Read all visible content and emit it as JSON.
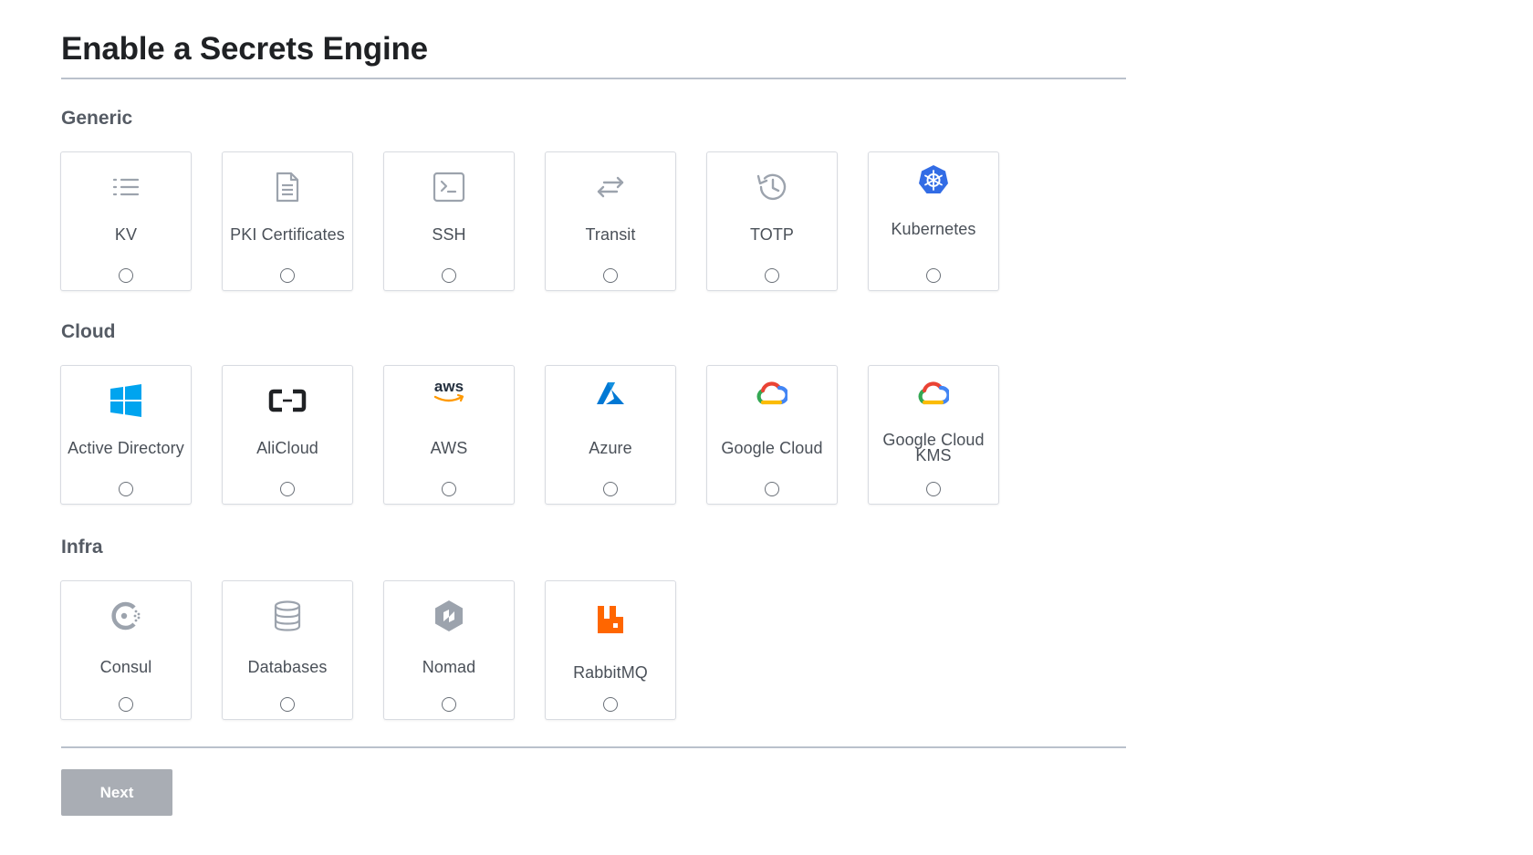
{
  "page_title": "Enable a Secrets Engine",
  "groups": [
    {
      "label": "Generic",
      "engines": [
        {
          "label": "KV",
          "icon": "list-icon",
          "color": "#9ca3ad"
        },
        {
          "label": "PKI Certificates",
          "icon": "document-icon",
          "color": "#9ca3ad"
        },
        {
          "label": "SSH",
          "icon": "terminal-icon",
          "color": "#9ca3ad"
        },
        {
          "label": "Transit",
          "icon": "swap-arrows-icon",
          "color": "#9ca3ad"
        },
        {
          "label": "TOTP",
          "icon": "history-clock-icon",
          "color": "#9ca3ad"
        },
        {
          "label": "Kubernetes",
          "icon": "kubernetes-icon",
          "color": "#326ce5"
        }
      ]
    },
    {
      "label": "Cloud",
      "engines": [
        {
          "label": "Active Directory",
          "icon": "windows-icon",
          "color": "#00a4ef"
        },
        {
          "label": "AliCloud",
          "icon": "alicloud-icon",
          "color": "#1f2124"
        },
        {
          "label": "AWS",
          "icon": "aws-icon",
          "color": "#232f3e"
        },
        {
          "label": "Azure",
          "icon": "azure-icon",
          "color": "#0078d4"
        },
        {
          "label": "Google Cloud",
          "icon": "google-cloud-icon",
          "color": "#4285f4"
        },
        {
          "label": "Google Cloud KMS",
          "icon": "google-cloud-icon",
          "color": "#4285f4"
        }
      ]
    },
    {
      "label": "Infra",
      "engines": [
        {
          "label": "Consul",
          "icon": "consul-icon",
          "color": "#9ca3ad"
        },
        {
          "label": "Databases",
          "icon": "database-icon",
          "color": "#9ca3ad"
        },
        {
          "label": "Nomad",
          "icon": "nomad-icon",
          "color": "#9ca3ad"
        },
        {
          "label": "RabbitMQ",
          "icon": "rabbitmq-icon",
          "color": "#ff6600"
        }
      ]
    }
  ],
  "next_button_label": "Next",
  "next_button_color": "#a9adb4",
  "aws_icon_text": "aws"
}
